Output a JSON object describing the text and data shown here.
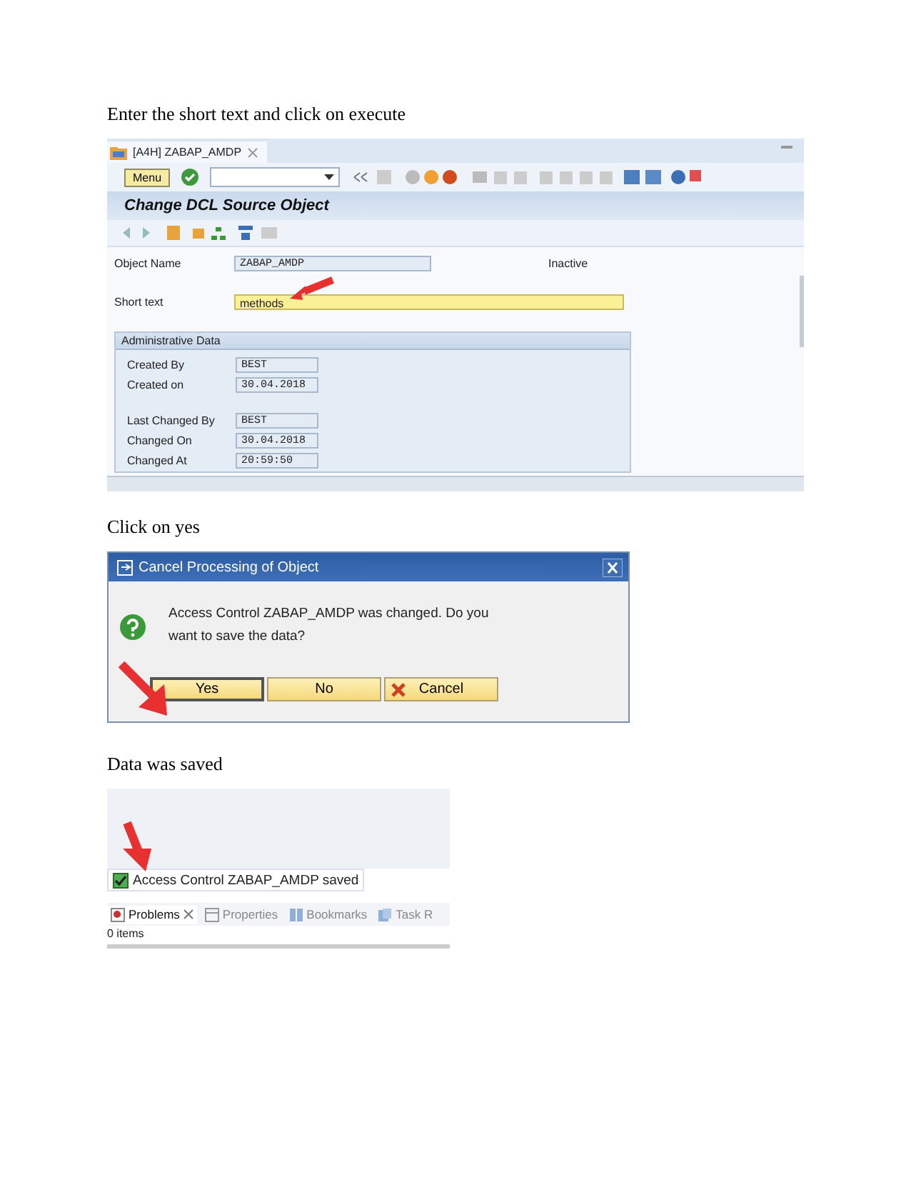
{
  "step1_caption": "Enter the short text and click on execute",
  "editor": {
    "tab": {
      "label": "[A4H] ZABAP_AMDP",
      "selected": true
    },
    "menu_button": "Menu",
    "title": "Change DCL Source Object",
    "object_name": {
      "label": "Object Name",
      "value": "ZABAP_AMDP",
      "status": "Inactive"
    },
    "short_text": {
      "label": "Short text",
      "value": "methods"
    },
    "admin": {
      "title": "Administrative Data",
      "groups": [
        [
          {
            "label": "Created By",
            "value": "BEST"
          },
          {
            "label": "Created on",
            "value": "30.04.2018"
          }
        ],
        [
          {
            "label": "Last Changed By",
            "value": "BEST"
          },
          {
            "label": "Changed On",
            "value": "30.04.2018"
          },
          {
            "label": "Changed At",
            "value": "20:59:50"
          }
        ]
      ]
    }
  },
  "step2_caption": "Click on yes",
  "dialog": {
    "title": "Cancel Processing of Object",
    "message": "Access Control ZABAP_AMDP was changed. Do you want to save the data?",
    "buttons": [
      {
        "label": "Yes",
        "kind": "plain",
        "selected": true
      },
      {
        "label": "No",
        "kind": "plain",
        "selected": false
      },
      {
        "label": "Cancel",
        "kind": "cancel",
        "selected": false
      }
    ]
  },
  "step3_caption": "Data was saved",
  "status": {
    "message": "Access Control ZABAP_AMDP saved",
    "checked": true,
    "tabs": [
      {
        "label": "Problems",
        "kind": "problems",
        "selected": true
      },
      {
        "label": "Properties",
        "kind": "properties",
        "selected": false
      },
      {
        "label": "Bookmarks",
        "kind": "bookmarks",
        "selected": false
      },
      {
        "label": "Task R",
        "kind": "tasks",
        "selected": false
      }
    ],
    "count": "0 items"
  }
}
